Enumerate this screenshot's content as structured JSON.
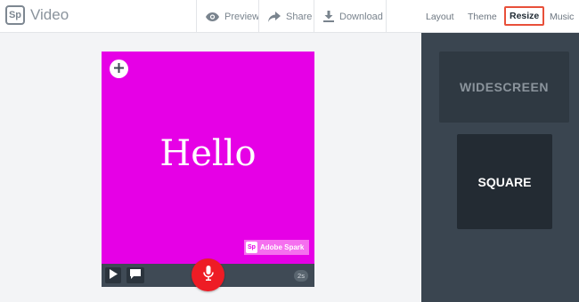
{
  "app": {
    "logo_text": "Sp",
    "title": "Video"
  },
  "toolbar": {
    "preview_label": "Preview",
    "share_label": "Share",
    "download_label": "Download"
  },
  "nav": {
    "layout_label": "Layout",
    "theme_label": "Theme",
    "resize_label": "Resize",
    "music_label": "Music",
    "active": "Resize"
  },
  "resize_panel": {
    "options": [
      {
        "label": "WIDESCREEN",
        "selected": false
      },
      {
        "label": "SQUARE",
        "selected": true
      }
    ]
  },
  "slide": {
    "text": "Hello",
    "background": "#e600e6",
    "watermark_logo": "Sp",
    "watermark_text": "Adobe Spark",
    "duration": "2s"
  },
  "colors": {
    "accent_highlight": "#e8503a",
    "record_button": "#ee1c25",
    "panel_bg": "#3a4550"
  },
  "icons": [
    "eye-icon",
    "share-arrow-icon",
    "download-icon",
    "plus-icon",
    "play-icon",
    "comment-icon",
    "microphone-icon"
  ]
}
